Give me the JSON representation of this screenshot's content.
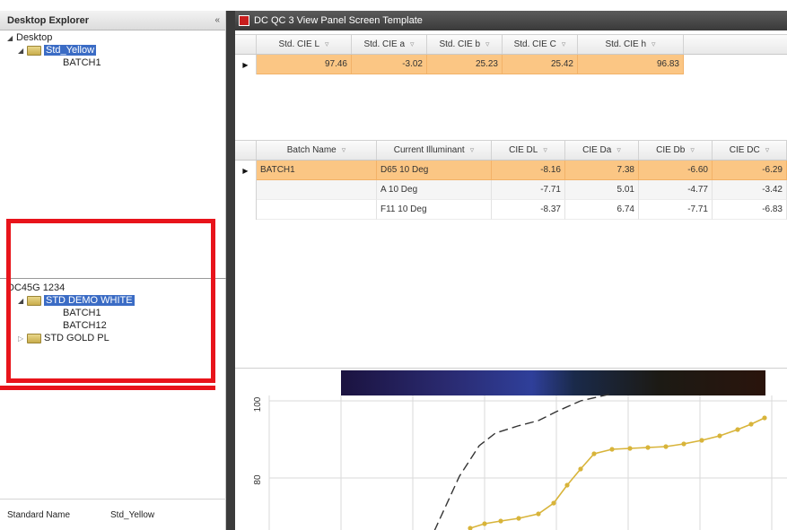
{
  "explorer": {
    "title": "Desktop Explorer",
    "collapse_glyph": "«",
    "tree1": {
      "root": "Desktop",
      "standard": "Std_Yellow",
      "batch": "BATCH1"
    },
    "tree2": {
      "root": "DC45G 1234",
      "standard": "STD DEMO WHITE",
      "batches": [
        "BATCH1",
        "BATCH12"
      ],
      "other": "STD GOLD PL"
    },
    "footer": {
      "label": "Standard Name",
      "value": "Std_Yellow"
    }
  },
  "window": {
    "title": "DC QC 3 View Panel Screen Template"
  },
  "std_grid": {
    "columns": [
      "Std. CIE L",
      "Std. CIE a",
      "Std. CIE b",
      "Std. CIE C",
      "Std. CIE h"
    ],
    "row": [
      "97.46",
      "-3.02",
      "25.23",
      "25.42",
      "96.83"
    ]
  },
  "batch_grid": {
    "columns": [
      "Batch Name",
      "Current Illuminant",
      "CIE DL",
      "CIE Da",
      "CIE Db",
      "CIE DC"
    ],
    "rows": [
      [
        "BATCH1",
        "D65 10 Deg",
        "-8.16",
        "7.38",
        "-6.60",
        "-6.29"
      ],
      [
        "",
        "A 10 Deg",
        "-7.71",
        "5.01",
        "-4.77",
        "-3.42"
      ],
      [
        "",
        "F11 10 Deg",
        "-8.37",
        "6.74",
        "-7.71",
        "-6.83"
      ]
    ]
  },
  "chart": {
    "y_ticks": [
      "100",
      "80"
    ],
    "accent": "#d8b43a",
    "dash_color": "#333333"
  },
  "colors": {
    "selection": "#3b6cc5",
    "row_highlight": "#fbc684",
    "callout": "#e8141b"
  }
}
